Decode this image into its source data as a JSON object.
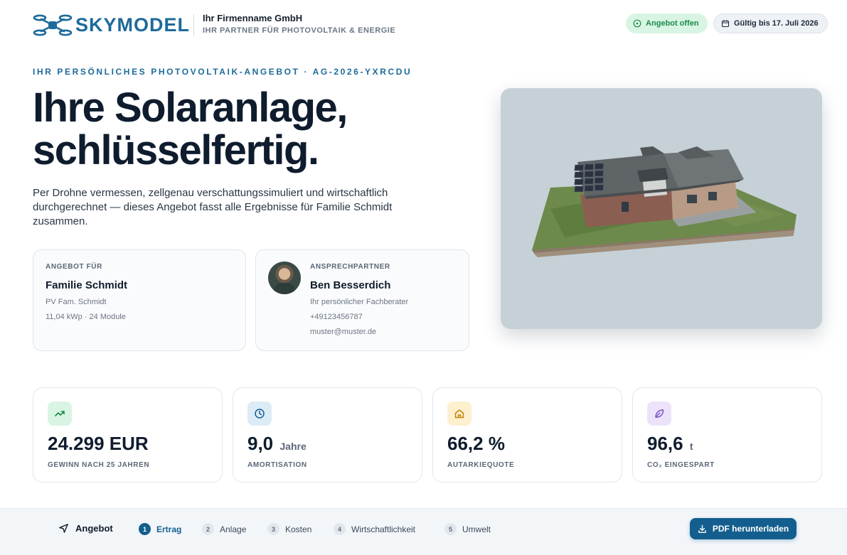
{
  "brand": {
    "logo_text": "SKYMODEL",
    "company_name": "Ihr Firmenname GmbH",
    "company_tagline": "IHR PARTNER FÜR PHOTOVOLTAIK & ENERGIE",
    "accent_color": "#1d6a9b"
  },
  "status": {
    "open_label": "Angebot offen",
    "valid_label": "Gültig bis 17. Juli 2026"
  },
  "hero": {
    "eyebrow": "IHR PERSÖNLICHES PHOTOVOLTAIK-ANGEBOT · AG-2026-YXRCDU",
    "title_line1": "Ihre Solaranlage,",
    "title_line2": "schlüsselfertig.",
    "lead": "Per Drohne vermessen, zellgenau verschattungssimuliert und wirtschaftlich durchgerechnet — dieses Angebot fasst alle Ergebnisse für Familie Schmidt zusammen."
  },
  "customer_card": {
    "label": "ANGEBOT FÜR",
    "name": "Familie Schmidt",
    "project": "PV Fam. Schmidt",
    "specs": "11,04 kWp · 24 Module"
  },
  "contact_card": {
    "label": "ANSPRECHPARTNER",
    "name": "Ben Besserdich",
    "role": "Ihr persönlicher Fachberater",
    "phone": "+49123456787",
    "email": "muster@muster.de"
  },
  "kpis": [
    {
      "value": "24.299 EUR",
      "unit": "",
      "label": "GEWINN NACH 25 JAHREN",
      "icon": "trending-up-icon",
      "color": "#1c8a4a",
      "bg": "#d8f5e3"
    },
    {
      "value": "9,0",
      "unit": "Jahre",
      "label": "AMORTISATION",
      "icon": "clock-icon",
      "color": "#135e8e",
      "bg": "#dcecf7"
    },
    {
      "value": "66,2 %",
      "unit": "",
      "label": "AUTARKIEQUOTE",
      "icon": "home-icon",
      "color": "#c7800a",
      "bg": "#fdf0cf"
    },
    {
      "value": "96,6",
      "unit": "t",
      "label": "CO₂ EINGESPART",
      "icon": "leaf-icon",
      "color": "#7b4bc4",
      "bg": "#ece3fa"
    }
  ],
  "nav": {
    "home_label": "Angebot",
    "steps": [
      {
        "num": "1",
        "label": "Ertrag"
      },
      {
        "num": "2",
        "label": "Anlage"
      },
      {
        "num": "3",
        "label": "Kosten"
      },
      {
        "num": "4",
        "label": "Wirtschaftlichkeit"
      },
      {
        "num": "5",
        "label": "Umwelt"
      }
    ],
    "pdf_label": "PDF herunterladen"
  }
}
